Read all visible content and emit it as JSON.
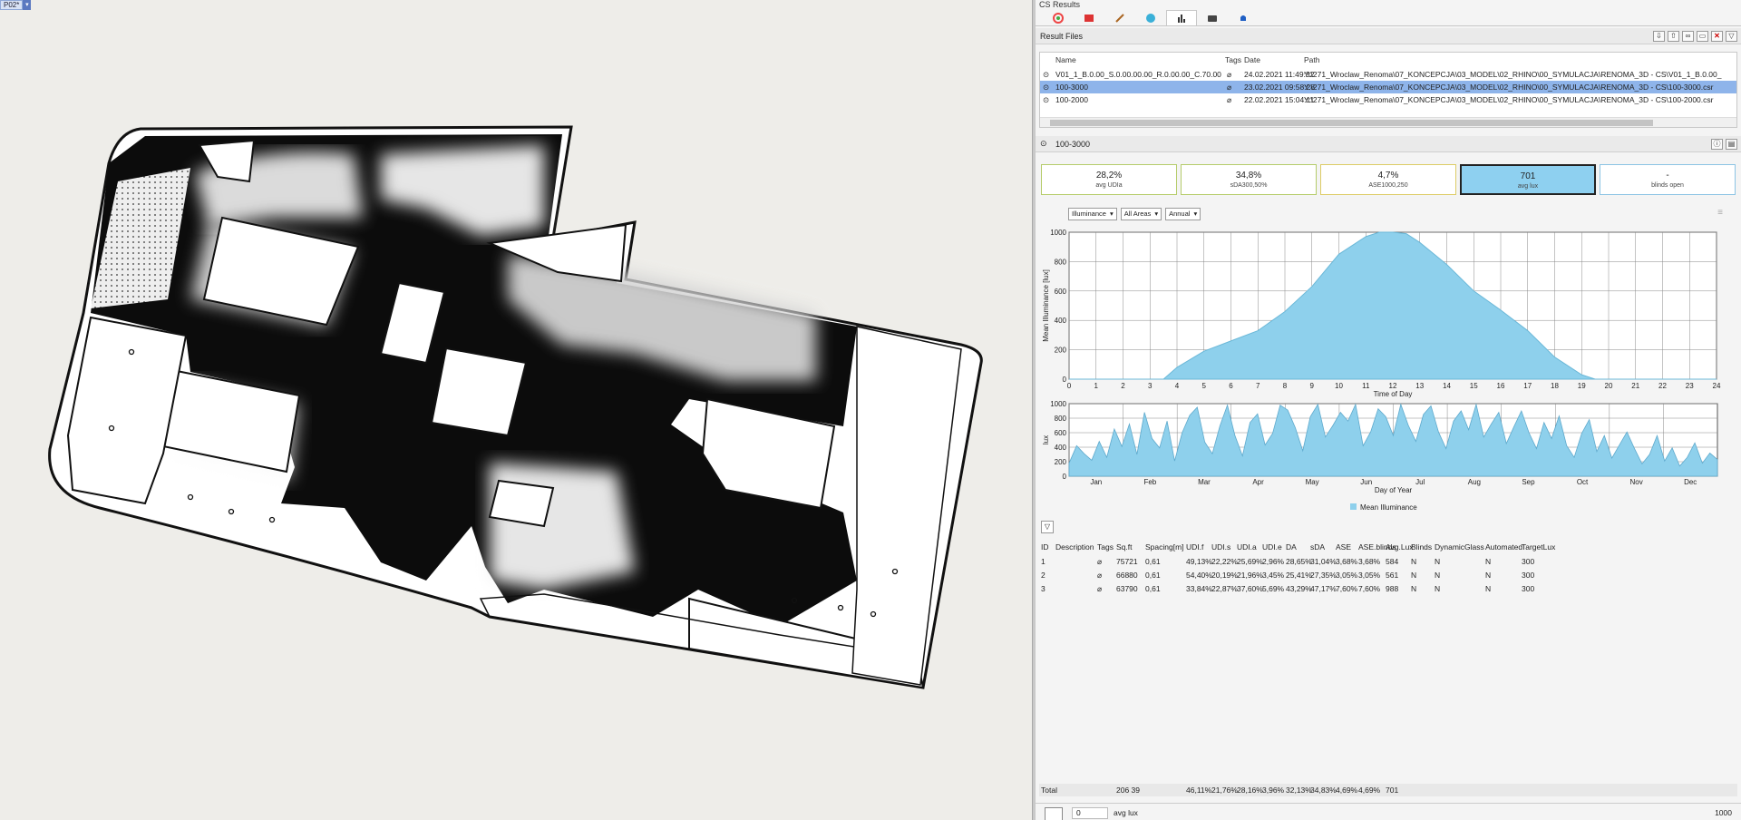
{
  "viewport": {
    "label": "P02*"
  },
  "panel": {
    "title": "CS Results",
    "toolbar_icons": [
      "color-wheel-icon",
      "layers-icon",
      "brush-icon",
      "grasshopper-icon",
      "chart-icon",
      "camera-icon",
      "bell-icon"
    ],
    "result_files": {
      "title": "Result Files",
      "columns": [
        "Name",
        "Tags",
        "Date",
        "Path"
      ],
      "rows": [
        {
          "name": "V01_1_B.0.00_S.0.00.00.00_R.0.00.00_C.70.00",
          "date": "24.02.2021 11:49:32",
          "path": "Y:\\271_Wroclaw_Renoma\\07_KONCEPCJA\\03_MODEL\\02_RHINO\\00_SYMULACJA\\RENOMA_3D - CS\\V01_1_B.0.00_",
          "selected": false
        },
        {
          "name": "100-3000",
          "date": "23.02.2021 09:58:28",
          "path": "Y:\\271_Wroclaw_Renoma\\07_KONCEPCJA\\03_MODEL\\02_RHINO\\00_SYMULACJA\\RENOMA_3D - CS\\100-3000.csr",
          "selected": true
        },
        {
          "name": "100-2000",
          "date": "22.02.2021 15:04:11",
          "path": "Y:\\271_Wroclaw_Renoma\\07_KONCEPCJA\\03_MODEL\\02_RHINO\\00_SYMULACJA\\RENOMA_3D - CS\\100-2000.csr",
          "selected": false
        }
      ]
    },
    "result_title": "100-3000",
    "kpis": [
      {
        "value": "28,2%",
        "label": "avg UDIa",
        "style": "green"
      },
      {
        "value": "34,8%",
        "label": "sDA300,50%",
        "style": "green"
      },
      {
        "value": "4,7%",
        "label": "ASE1000,250",
        "style": "yellow"
      },
      {
        "value": "701",
        "label": "avg lux",
        "style": "active"
      },
      {
        "value": "-",
        "label": "blinds open",
        "style": "blue"
      }
    ],
    "dropdowns": [
      "Illuminance",
      "All Areas",
      "Annual"
    ],
    "legend": "Mean Illuminance",
    "table": {
      "columns": [
        "ID",
        "Description",
        "Tags",
        "Sq.ft",
        "Spacing[m]",
        "UDI.f",
        "UDI.s",
        "UDI.a",
        "UDI.e",
        "DA",
        "sDA",
        "ASE",
        "ASE.blinds",
        "Avg.Lux",
        "Blinds",
        "DynamicGlass",
        "Automated",
        "TargetLux"
      ],
      "rows": [
        [
          "1",
          "",
          "",
          "75721",
          "0,61",
          "49,13%",
          "22,22%",
          "25,69%",
          "2,96%",
          "28,65%",
          "31,04%",
          "3,68%",
          "3,68%",
          "584",
          "N",
          "N",
          "N",
          "300"
        ],
        [
          "2",
          "",
          "",
          "66880",
          "0,61",
          "54,40%",
          "20,19%",
          "21,96%",
          "3,45%",
          "25,41%",
          "27,35%",
          "3,05%",
          "3,05%",
          "561",
          "N",
          "N",
          "N",
          "300"
        ],
        [
          "3",
          "",
          "",
          "63790",
          "0,61",
          "33,84%",
          "22,87%",
          "37,60%",
          "5,69%",
          "43,29%",
          "47,17%",
          "7,60%",
          "7,60%",
          "988",
          "N",
          "N",
          "N",
          "300"
        ]
      ],
      "total": [
        "Total",
        "",
        "",
        "206 39",
        "",
        "46,11%",
        "21,76%",
        "28,16%",
        "3,96%",
        "32,13%",
        "34,83%",
        "4,69%",
        "4,69%",
        "701"
      ]
    },
    "bottom_bar": {
      "min": "0",
      "label": "avg lux",
      "max": "1000"
    }
  },
  "chart_data": [
    {
      "type": "area",
      "title": "",
      "xlabel": "Time of Day",
      "ylabel": "Mean Illuminance [lux]",
      "x": [
        0,
        1,
        2,
        3,
        3.5,
        4,
        5,
        6,
        7,
        8,
        9,
        10,
        11,
        11.5,
        12,
        12.5,
        13,
        14,
        15,
        16,
        17,
        18,
        19,
        19.5,
        20,
        21,
        22,
        23,
        24
      ],
      "y": [
        0,
        0,
        0,
        0,
        0,
        80,
        190,
        260,
        330,
        460,
        630,
        850,
        970,
        1000,
        1010,
        990,
        930,
        780,
        600,
        470,
        330,
        150,
        30,
        0,
        0,
        0,
        0,
        0,
        0
      ],
      "xlim": [
        0,
        24
      ],
      "ylim": [
        0,
        1000
      ],
      "x_ticks": [
        0,
        1,
        2,
        3,
        4,
        5,
        6,
        7,
        8,
        9,
        10,
        11,
        12,
        13,
        14,
        15,
        16,
        17,
        18,
        19,
        20,
        21,
        22,
        23,
        24
      ],
      "y_ticks": [
        0,
        200,
        400,
        600,
        800,
        1000
      ],
      "color": "#8ed0ec",
      "grid": true
    },
    {
      "type": "area",
      "title": "",
      "xlabel": "Day of Year",
      "ylabel": "lux",
      "categories": [
        "Jan",
        "Feb",
        "Mar",
        "Apr",
        "May",
        "Jun",
        "Jul",
        "Aug",
        "Sep",
        "Oct",
        "Nov",
        "Dec"
      ],
      "y_ticks": [
        0,
        200,
        400,
        600,
        800,
        1000
      ],
      "ylim": [
        0,
        1000
      ],
      "series": [
        {
          "name": "Mean Illuminance",
          "values": [
            180,
            420,
            310,
            220,
            480,
            260,
            650,
            410,
            720,
            300,
            880,
            520,
            390,
            760,
            210,
            600,
            840,
            950,
            470,
            310,
            690,
            980,
            560,
            280,
            740,
            860,
            430,
            590,
            980,
            910,
            670,
            350,
            820,
            990,
            540,
            700,
            880,
            760,
            990,
            420,
            610,
            930,
            820,
            560,
            990,
            700,
            480,
            850,
            970,
            610,
            380,
            760,
            900,
            640,
            990,
            540,
            720,
            880,
            450,
            680,
            900,
            600,
            380,
            740,
            520,
            830,
            420,
            260,
            590,
            780,
            340,
            560,
            250,
            430,
            610,
            380,
            170,
            300,
            560,
            210,
            390,
            140,
            260,
            460,
            180,
            320,
            230
          ]
        }
      ],
      "color": "#8ed0ec",
      "grid": true
    }
  ]
}
